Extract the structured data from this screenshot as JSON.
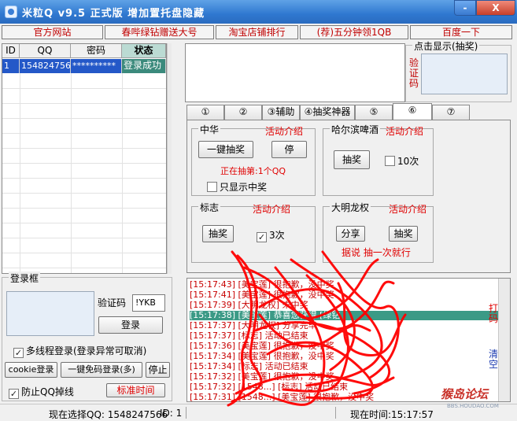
{
  "window": {
    "title": "米粒Q v9.5 正式版  增加置托盘隐藏",
    "minimize_label": "-",
    "close_label": "X"
  },
  "links": [
    {
      "label": "官方网站"
    },
    {
      "label": "春哔绿钻赠送大号"
    },
    {
      "label": "淘宝店铺排行"
    },
    {
      "label": "(荐)五分钟领1QB"
    },
    {
      "label": "百度一下"
    }
  ],
  "account_table": {
    "headers": [
      "ID",
      "QQ",
      "密码",
      "状态"
    ],
    "rows": [
      {
        "id": "1",
        "qq": "1548247566",
        "password": "**********",
        "status": "登录成功"
      }
    ]
  },
  "login_panel": {
    "legend": "登录框",
    "captcha_label": "验证码",
    "captcha_value": "!YKB",
    "login_button": "登录",
    "multithread_checkbox": "多线程登录(登录异常可取消)",
    "multithread_checked": true,
    "cookie_button": "cookie登录",
    "no_captcha_button": "一键免码登录(多)",
    "stop_button": "停止",
    "anti_drop_checkbox": "防止QQ掉线",
    "anti_drop_checked": true,
    "standard_time_button": "标准时间"
  },
  "click_display": {
    "legend": "点击显示(抽奖)",
    "vcode_label": "验证码"
  },
  "tabs": [
    "①",
    "②",
    "③辅助",
    "④抽奖神器",
    "⑤",
    "⑥",
    "⑦"
  ],
  "active_tab": "⑥",
  "groups": {
    "zhonghua": {
      "title": "中华",
      "intro": "活动介绍",
      "draw_button": "一键抽奖",
      "stop_button": "停",
      "status": "正在抽第:1个QQ",
      "only_winning_checkbox": "只显示中奖",
      "only_winning_checked": false
    },
    "harbin": {
      "title": "哈尔滨啤酒",
      "intro": "活动介绍",
      "draw_button": "抽奖",
      "times_checkbox": "10次",
      "times_checked": false
    },
    "biaozhi": {
      "title": "标志",
      "intro": "活动介绍",
      "draw_button": "抽奖",
      "times_checkbox": "3次",
      "times_checked": true
    },
    "daminglongquan": {
      "title": "大明龙权",
      "intro": "活动介绍",
      "share_button": "分享",
      "draw_button": "抽奖",
      "note": "据说 抽一次就行"
    }
  },
  "log": {
    "lines": [
      {
        "time": "[15:17:43]",
        "text": "[美宝莲] 很抱歉，没中奖",
        "selected": false
      },
      {
        "time": "[15:17:41]",
        "text": "[美宝莲] 很抱歉，没中奖",
        "selected": false
      },
      {
        "time": "[15:17:39]",
        "text": "[大明龙权] 未中奖",
        "selected": false
      },
      {
        "time": "[15:17:38]",
        "text": "[美宝莲] 恭喜您获得 [绿钻",
        "selected": true
      },
      {
        "time": "[15:17:37]",
        "text": "[大明龙权] 分享完毕",
        "selected": false
      },
      {
        "time": "[15:17:37]",
        "text": "[标志] 活动已结束",
        "selected": false
      },
      {
        "time": "[15:17:36]",
        "text": "[美宝莲] 很抱歉，没中奖",
        "selected": false
      },
      {
        "time": "[15:17:34]",
        "text": "[美宝莲] 很抱歉，没中奖",
        "selected": false
      },
      {
        "time": "[15:17:34]",
        "text": "[标志] 活动已结束",
        "selected": false
      },
      {
        "time": "[15:17:32]",
        "text": "[美宝莲] 很抱歉，没中奖",
        "selected": false
      },
      {
        "time": "[15:17:32]",
        "text": "[1548...] [标志] 活动已结束",
        "selected": false
      },
      {
        "time": "[15:17:31]",
        "text": "[1548...] [美宝莲] 很抱歉，没中奖",
        "selected": false
      }
    ],
    "side_label_top": "打码",
    "side_label_bottom": "清空"
  },
  "statusbar": {
    "current_qq": "现在选择QQ: 1548247566",
    "current_id": "ID: 1",
    "current_time": "现在时间:15:17:57"
  },
  "watermark": {
    "text": "猴岛论坛",
    "sub": "BBS.HOUDAO.COM"
  },
  "colors": {
    "titlebar": "#2f78d0",
    "selection_blue": "#2458c8",
    "selection_green": "#3b9a86",
    "accent_red": "#e00000"
  }
}
